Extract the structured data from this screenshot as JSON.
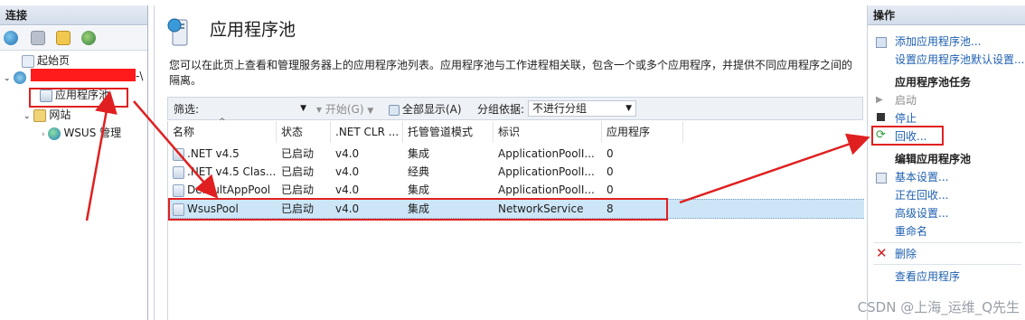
{
  "connections": {
    "title": "连接",
    "tree": {
      "start_page": "起始页",
      "server_suffix": "-\\",
      "app_pools": "应用程序池",
      "sites": "网站",
      "wsus": "WSUS 管理"
    }
  },
  "main": {
    "title": "应用程序池",
    "description": "您可以在此页上查看和管理服务器上的应用程序池列表。应用程序池与工作进程相关联，包含一个或多个应用程序，并提供不同应用程序之间的隔离。",
    "filterbar": {
      "filter_label": "筛选:",
      "start_label": "开始(G)",
      "show_all_label": "全部显示(A)",
      "group_by_label": "分组依据:",
      "group_by_value": "不进行分组"
    },
    "columns": [
      "名称",
      "状态",
      ".NET CLR ...",
      "托管管道模式",
      "标识",
      "应用程序"
    ],
    "rows": [
      [
        ".NET v4.5",
        "已启动",
        "v4.0",
        "集成",
        "ApplicationPoolI...",
        "0"
      ],
      [
        ".NET v4.5 Clas...",
        "已启动",
        "v4.0",
        "经典",
        "ApplicationPoolI...",
        "0"
      ],
      [
        "DefaultAppPool",
        "已启动",
        "v4.0",
        "集成",
        "ApplicationPoolI...",
        "0"
      ],
      [
        "WsusPool",
        "已启动",
        "v4.0",
        "集成",
        "NetworkService",
        "8"
      ]
    ],
    "selected_row": 3
  },
  "actions": {
    "title": "操作",
    "add_pool": "添加应用程序池...",
    "set_defaults": "设置应用程序池默认设置...",
    "pool_tasks_header": "应用程序池任务",
    "start": "启动",
    "stop": "停止",
    "recycle": "回收...",
    "edit_header": "编辑应用程序池",
    "basic_settings": "基本设置...",
    "recycling": "正在回收...",
    "advanced_settings": "高级设置...",
    "rename": "重命名",
    "delete": "删除",
    "view_apps": "查看应用程序"
  },
  "watermark": "CSDN @上海_运维_Q先生",
  "colors": {
    "annotation_red": "#e02020",
    "selection_blue": "#cde6f7",
    "link_blue": "#1d5fb0"
  }
}
